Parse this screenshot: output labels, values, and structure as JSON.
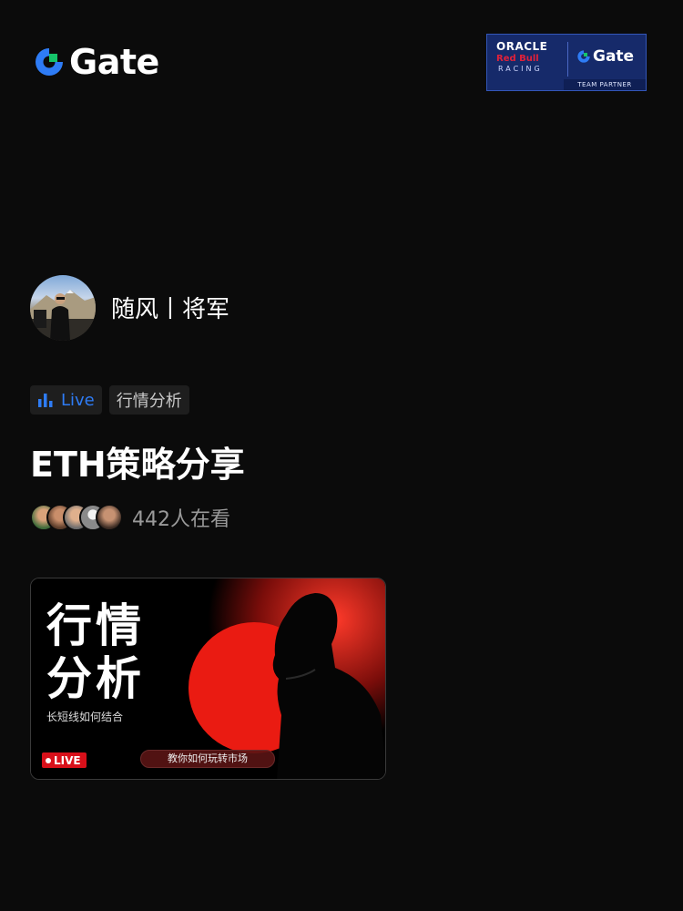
{
  "brand": {
    "name": "Gate",
    "accent": "#2e7cf6",
    "green": "#15c46a"
  },
  "sponsor": {
    "oracle": "ORACLE",
    "redbull": "Red Bull",
    "racing": "RACING",
    "gate": "Gate",
    "team_partner": "TEAM PARTNER"
  },
  "host": {
    "name": "随风丨将军",
    "avatar_icon": "avatar-photo"
  },
  "tags": {
    "live": "Live",
    "category": "行情分析"
  },
  "stream": {
    "title": "ETH策略分享"
  },
  "viewers": {
    "count_text": "442人在看"
  },
  "thumbnail": {
    "line1": "行情",
    "line2": "分析",
    "subtitle": "长短线如何结合",
    "live": "LIVE",
    "pill": "教你如何玩转市场"
  }
}
